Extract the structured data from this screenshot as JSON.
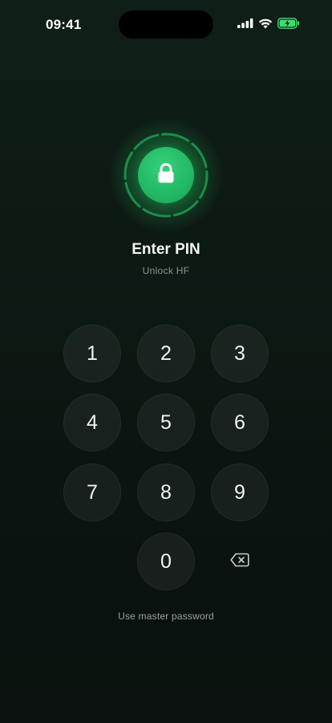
{
  "status_bar": {
    "time": "09:41",
    "icons": [
      "cellular-signal-icon",
      "wifi-icon",
      "battery-charging-icon"
    ]
  },
  "lock": {
    "icon": "padlock-icon",
    "accent": "#22c55e"
  },
  "header": {
    "title": "Enter PIN",
    "subtitle": "Unlock HF"
  },
  "keypad": {
    "keys": [
      "1",
      "2",
      "3",
      "4",
      "5",
      "6",
      "7",
      "8",
      "9",
      "0"
    ],
    "delete_icon": "backspace-icon"
  },
  "footer": {
    "alt_link": "Use master password"
  }
}
